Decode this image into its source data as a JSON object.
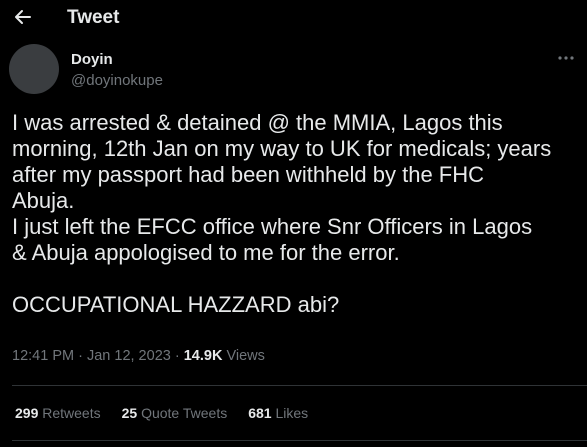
{
  "header": {
    "title": "Tweet"
  },
  "author": {
    "display_name": "Doyin",
    "handle": "@doyinokupe"
  },
  "tweet": {
    "lines": [
      "I was arrested & detained @ the MMIA, Lagos this",
      "morning, 12th Jan on my way to UK for medicals; years",
      "after my passport had been withheld by the FHC",
      "Abuja.",
      "I just left the EFCC office where Snr Officers in Lagos",
      "& Abuja appologised to me for the error.",
      "",
      "OCCUPATIONAL HAZZARD abi?"
    ]
  },
  "meta": {
    "time": "12:41 PM",
    "separator1": " · ",
    "date": "Jan 12, 2023",
    "separator2": " · ",
    "views_count": "14.9K",
    "views_label": " Views"
  },
  "stats": {
    "retweets_count": "299",
    "retweets_label": " Retweets",
    "quotes_count": "25",
    "quotes_label": " Quote Tweets",
    "likes_count": "681",
    "likes_label": " Likes"
  },
  "colors": {
    "background": "#000000",
    "primary_text": "#e7e9ea",
    "secondary_text": "#71767b",
    "divider": "#2f3336",
    "avatar_placeholder": "#3a3d40"
  },
  "icons": {
    "back": "arrow-left-icon",
    "more": "more-horizontal-icon"
  }
}
